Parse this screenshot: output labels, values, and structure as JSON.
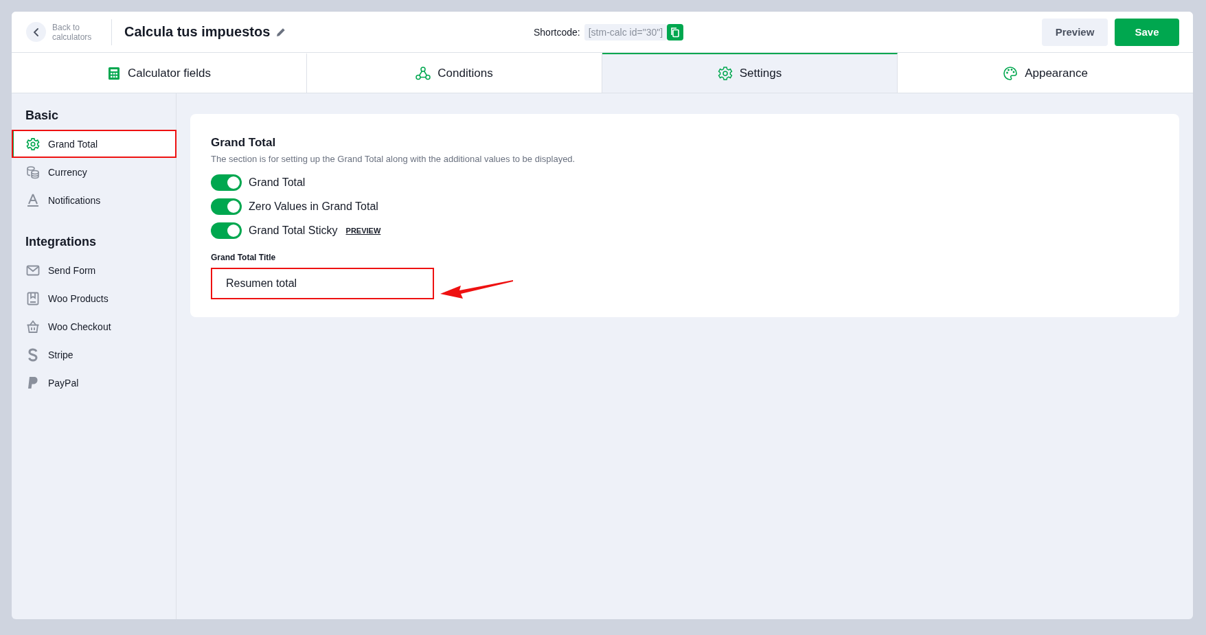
{
  "header": {
    "back_label": "Back to calculators",
    "title": "Calcula tus impuestos",
    "shortcode_label": "Shortcode:",
    "shortcode": "[stm-calc id=\"30\"]",
    "buttons": [
      {
        "label": "Preview",
        "kind": "secondary"
      },
      {
        "label": "Save",
        "kind": "primary"
      }
    ]
  },
  "tabs": [
    {
      "label": "Calculator fields",
      "selected": false
    },
    {
      "label": "Conditions",
      "selected": false
    },
    {
      "label": "Settings",
      "selected": true
    },
    {
      "label": "Appearance",
      "selected": false
    }
  ],
  "sidebar": {
    "sections": [
      {
        "title": "Basic",
        "items": [
          {
            "label": "Grand Total",
            "selected": true,
            "highlighted": true
          },
          {
            "label": "Currency",
            "selected": false,
            "highlighted": false
          },
          {
            "label": "Notifications",
            "selected": false,
            "highlighted": false
          }
        ]
      },
      {
        "title": "Integrations",
        "items": [
          {
            "label": "Send Form",
            "selected": false,
            "highlighted": false
          },
          {
            "label": "Woo Products",
            "selected": false,
            "highlighted": false
          },
          {
            "label": "Woo Checkout",
            "selected": false,
            "highlighted": false
          },
          {
            "label": "Stripe",
            "selected": false,
            "highlighted": false
          },
          {
            "label": "PayPal",
            "selected": false,
            "highlighted": false
          }
        ]
      }
    ]
  },
  "panel": {
    "title": "Grand Total",
    "description": "The section is for setting up the Grand Total along with the additional values to be displayed.",
    "toggles": [
      {
        "label": "Grand Total",
        "on": true
      },
      {
        "label": "Zero Values in Grand Total",
        "on": true
      },
      {
        "label": "Grand Total Sticky",
        "on": true,
        "link": "PREVIEW"
      }
    ],
    "field": {
      "label": "Grand Total Title",
      "value": "Resumen total",
      "highlighted": true
    }
  }
}
